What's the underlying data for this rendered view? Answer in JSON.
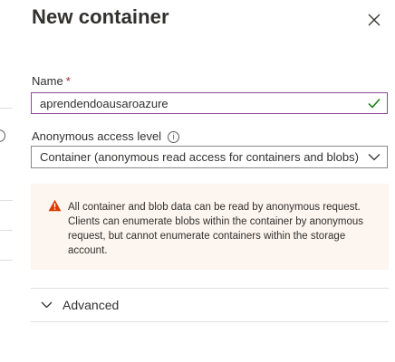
{
  "panel": {
    "title": "New container",
    "close_icon": "close-icon"
  },
  "name_field": {
    "label": "Name",
    "required_marker": "*",
    "value": "aprendendoausaroazure",
    "status_icon": "checkmark-icon",
    "status_color": "#107c10"
  },
  "access_level": {
    "label": "Anonymous access level",
    "info_icon": "info-icon",
    "info_glyph": "i",
    "selected": "Container (anonymous read access for containers and blobs)"
  },
  "warning": {
    "icon": "warning-icon",
    "icon_color": "#d83b01",
    "background": "#fdf5ef",
    "text": "All container and blob data can be read by anonymous request. Clients can enumerate blobs within the container by anonymous request, but cannot enumerate containers within the storage account."
  },
  "advanced": {
    "label": "Advanced",
    "icon": "chevron-down-icon"
  },
  "colors": {
    "input_focus_border": "#8a4b9a",
    "required": "#a4262c"
  }
}
